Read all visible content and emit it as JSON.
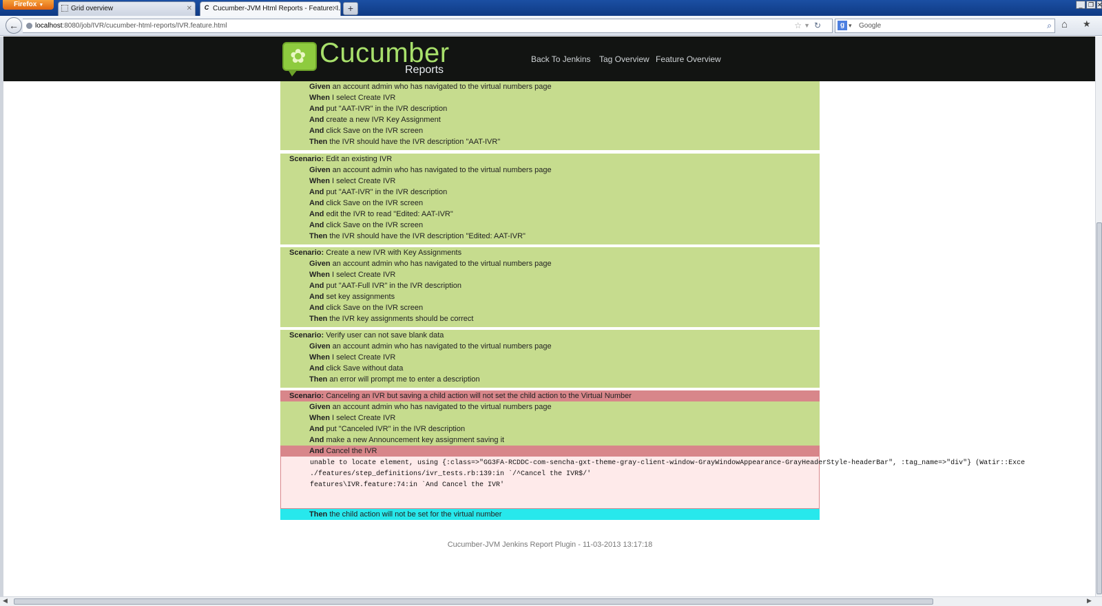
{
  "browser": {
    "menu_label": "Firefox",
    "tabs": [
      {
        "title": "Grid overview"
      },
      {
        "title": "Cucumber-JVM Html Reports - Feature: I..."
      }
    ],
    "url_host": "localhost",
    "url_rest": ":8080/job/IVR/cucumber-html-reports/IVR.feature.html",
    "search_placeholder": "Google"
  },
  "header": {
    "logo_title": "Cucumber",
    "logo_subtitle": "Reports",
    "nav": [
      "Back To Jenkins",
      "Tag Overview",
      "Feature Overview"
    ]
  },
  "scenarios": [
    {
      "title": null,
      "steps": [
        {
          "kw": "Given",
          "text": " an account admin who has navigated to the virtual numbers page"
        },
        {
          "kw": "When",
          "text": " I select Create IVR"
        },
        {
          "kw": "And",
          "text": " put \"AAT-IVR\" in the IVR description"
        },
        {
          "kw": "And",
          "text": " create a new IVR Key Assignment"
        },
        {
          "kw": "And",
          "text": " click Save on the IVR screen"
        },
        {
          "kw": "Then",
          "text": " the IVR should have the IVR description \"AAT-IVR\""
        }
      ]
    },
    {
      "title": "Edit an existing IVR",
      "steps": [
        {
          "kw": "Given",
          "text": " an account admin who has navigated to the virtual numbers page"
        },
        {
          "kw": "When",
          "text": " I select Create IVR"
        },
        {
          "kw": "And",
          "text": " put \"AAT-IVR\" in the IVR description"
        },
        {
          "kw": "And",
          "text": " click Save on the IVR screen"
        },
        {
          "kw": "And",
          "text": " edit the IVR to read \"Edited: AAT-IVR\""
        },
        {
          "kw": "And",
          "text": " click Save on the IVR screen"
        },
        {
          "kw": "Then",
          "text": " the IVR should have the IVR description \"Edited: AAT-IVR\""
        }
      ]
    },
    {
      "title": "Create a new IVR with Key Assignments",
      "steps": [
        {
          "kw": "Given",
          "text": " an account admin who has navigated to the virtual numbers page"
        },
        {
          "kw": "When",
          "text": " I select Create IVR"
        },
        {
          "kw": "And",
          "text": " put \"AAT-Full IVR\" in the IVR description"
        },
        {
          "kw": "And",
          "text": " set key assignments"
        },
        {
          "kw": "And",
          "text": " click Save on the IVR screen"
        },
        {
          "kw": "Then",
          "text": " the IVR key assignments should be correct"
        }
      ]
    },
    {
      "title": "Verify user can not save blank data",
      "steps": [
        {
          "kw": "Given",
          "text": " an account admin who has navigated to the virtual numbers page"
        },
        {
          "kw": "When",
          "text": " I select Create IVR"
        },
        {
          "kw": "And",
          "text": " click Save without data"
        },
        {
          "kw": "Then",
          "text": " an error will prompt me to enter a description"
        }
      ]
    }
  ],
  "failed_scenario": {
    "scenario_label": "Scenario:",
    "title": " Canceling an IVR but saving a child action will not set the child action to the Virtual Number",
    "steps": [
      {
        "kw": "Given",
        "text": " an account admin who has navigated to the virtual numbers page"
      },
      {
        "kw": "When",
        "text": " I select Create IVR"
      },
      {
        "kw": "And",
        "text": " put \"Canceled IVR\" in the IVR description"
      },
      {
        "kw": "And",
        "text": " make a new Announcement key assignment saving it"
      }
    ],
    "failed_step": {
      "kw": "And",
      "text": " Cancel the IVR"
    },
    "error_lines": [
      "unable to locate element, using {:class=>\"GG3FA-RCDDC-com-sencha-gxt-theme-gray-client-window-GrayWindowAppearance-GrayHeaderStyle-headerBar\", :tag_name=>\"div\"} (Watir::Exce",
      "./features/step_definitions/ivr_tests.rb:139:in `/^Cancel the IVR$/'",
      "features\\IVR.feature:74:in `And Cancel the IVR'"
    ],
    "skipped_step": {
      "kw": "Then",
      "text": " the child action will not be set for the virtual number"
    }
  },
  "scenario_label": "Scenario:",
  "footer": "Cucumber-JVM Jenkins Report Plugin - 11-03-2013 13:17:18",
  "colors": {
    "passed": "#c6dc8e",
    "failed": "#d8868a",
    "skipped": "#27e8ec",
    "error_bg": "#feeaea",
    "header_bg": "#121412"
  }
}
